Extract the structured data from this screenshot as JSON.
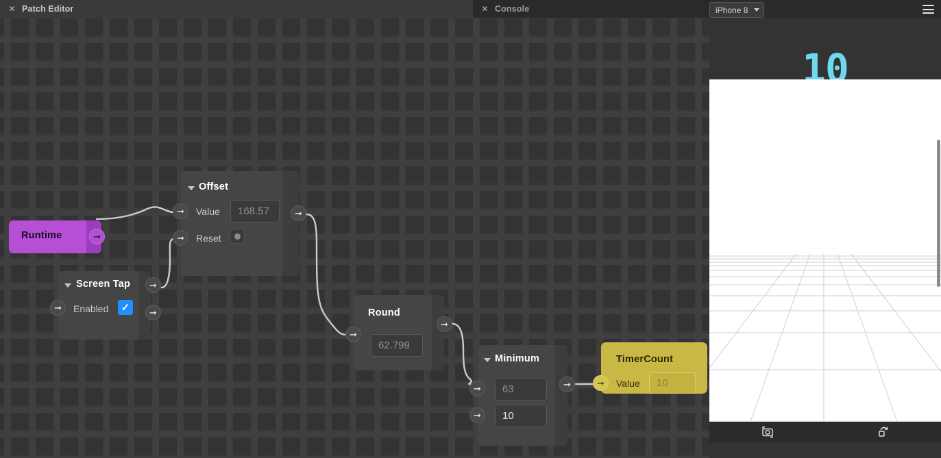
{
  "window": {
    "tabs": [
      {
        "label": "Patch Editor",
        "close_icon": "close-icon",
        "active": true
      },
      {
        "label": "Console",
        "close_icon": "close-icon",
        "active": false
      }
    ],
    "device_selector": {
      "value": "iPhone 8",
      "chevron": "chevron-down-icon"
    },
    "menu_icon": "hamburger-menu-icon"
  },
  "canvas": {
    "background_color": "#333333",
    "wire_color": "#c9cbd0",
    "nodes": [
      {
        "id": "runtime",
        "title": "Runtime",
        "color": "#b44fd6",
        "outputs": [
          {
            "name": "output-port",
            "icon": "arrow-right-icon"
          }
        ]
      },
      {
        "id": "screen-tap",
        "title": "Screen Tap",
        "disclosure": "triangle-down-icon",
        "rows": [
          {
            "label": "Enabled",
            "control": "checkbox",
            "checked": true
          }
        ],
        "inputs": [
          {
            "name": "input-port",
            "icon": "arrow-right-icon"
          }
        ],
        "outputs": [
          {
            "name": "output-port-1",
            "icon": "arrow-right-icon"
          },
          {
            "name": "output-port-2",
            "icon": "arrow-right-icon"
          }
        ]
      },
      {
        "id": "offset",
        "title": "Offset",
        "disclosure": "triangle-down-icon",
        "rows": [
          {
            "label": "Value",
            "control": "field",
            "value": "168.57",
            "editable": false
          },
          {
            "label": "Reset",
            "control": "pulse",
            "value": ""
          }
        ],
        "inputs": [
          {
            "name": "value-input-port",
            "icon": "arrow-right-icon"
          },
          {
            "name": "reset-input-port",
            "icon": "arrow-right-icon"
          }
        ],
        "outputs": [
          {
            "name": "output-port",
            "icon": "arrow-right-icon"
          }
        ]
      },
      {
        "id": "round",
        "title": "Round",
        "rows": [
          {
            "label": "",
            "control": "field",
            "value": "62.799",
            "editable": false
          }
        ],
        "inputs": [
          {
            "name": "input-port",
            "icon": "arrow-right-icon"
          }
        ],
        "outputs": [
          {
            "name": "output-port",
            "icon": "arrow-right-icon"
          }
        ]
      },
      {
        "id": "minimum",
        "title": "Minimum",
        "disclosure": "triangle-down-icon",
        "rows": [
          {
            "label": "",
            "control": "field",
            "value": "63",
            "editable": false
          },
          {
            "label": "",
            "control": "field",
            "value": "10",
            "editable": true
          }
        ],
        "inputs": [
          {
            "name": "input-port-1",
            "icon": "arrow-right-icon"
          },
          {
            "name": "input-port-2",
            "icon": "arrow-right-icon"
          }
        ],
        "outputs": [
          {
            "name": "output-port",
            "icon": "arrow-right-icon"
          }
        ]
      },
      {
        "id": "timercount",
        "title": "TimerCount",
        "color": "#c9b845",
        "rows": [
          {
            "label": "Value",
            "control": "field",
            "value": "10",
            "editable": false
          }
        ],
        "inputs": [
          {
            "name": "value-input-port",
            "icon": "arrow-right-icon"
          }
        ]
      }
    ]
  },
  "preview": {
    "display_value": "10",
    "display_color": "#6fd9ec",
    "scene": "perspective-grid-floor",
    "toolbar": [
      {
        "name": "switch-camera-icon",
        "label": ""
      },
      {
        "name": "reset-rotation-icon",
        "label": ""
      }
    ]
  }
}
